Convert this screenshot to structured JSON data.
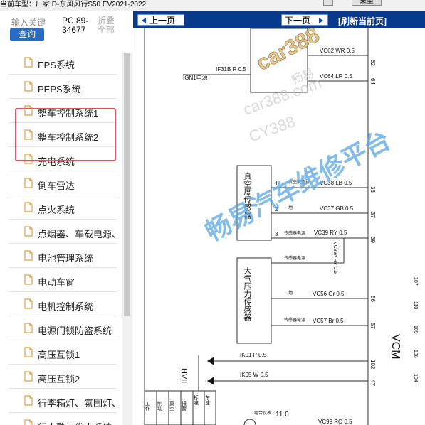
{
  "topbar": {
    "current_model": "当前车型：厂家:D-东风风行S50 EV2021-2022",
    "btn_a": "集重"
  },
  "search": {
    "placeholder_hint": "输入关键",
    "query_label": "查询",
    "code": "PC.89-34677",
    "fold_label": "折叠全部"
  },
  "sidebar": {
    "items": [
      {
        "label": "EPS系统"
      },
      {
        "label": "PEPS系统"
      },
      {
        "label": "整车控制系统1"
      },
      {
        "label": "整车控制系统2"
      },
      {
        "label": "充电系统"
      },
      {
        "label": "倒车雷达"
      },
      {
        "label": "点火系统"
      },
      {
        "label": "点烟器、车载电源、"
      },
      {
        "label": "电池管理系统"
      },
      {
        "label": "电动车窗"
      },
      {
        "label": "电机控制系统"
      },
      {
        "label": "电源门锁防盗系统"
      },
      {
        "label": "高压互锁1"
      },
      {
        "label": "高压互锁2"
      },
      {
        "label": "行李箱灯、氛围灯、"
      },
      {
        "label": "行人警示发声系统"
      }
    ]
  },
  "nav": {
    "prev_label": "上一页",
    "next_label": "下一页",
    "refresh_label": "[刷新当前页]"
  },
  "diagram": {
    "ign1": "IGN1电源",
    "f31b": "IF31B R 0.5",
    "vc62": "VC62 WR 0.5",
    "vc64": "VC64 LR 0.5",
    "pin62": "62",
    "pin64": "64",
    "vac_sensor": "真空度传感器",
    "vac_signal": "真空度信号",
    "vc38": "VC38 LB 0.5",
    "pin38": "38",
    "gnd": "地",
    "vc37": "VC37 GB 0.5",
    "pin37": "37",
    "sensor_pwr": "传感器电源",
    "vc39": "VC39 RY 0.5",
    "pin39": "39",
    "vc39a": "VC39A RY 0.5",
    "atm_sensor": "大气压力传感器",
    "vc56": "VC56 Gr 0.5",
    "pin56": "56",
    "vc57": "VC57 Br 0.5",
    "pin57": "57",
    "vcm": "VCM",
    "hvil": "HVIL",
    "ik01": "IK01 P 0.5",
    "ik05": "IK05 W 0.5",
    "pin102": "102",
    "pin47": "47",
    "pin107": "107",
    "pin110": "110",
    "pin109": "109",
    "pin108": "108",
    "pin104": "104",
    "combo": "组合仪表",
    "combo_pin": "11.0",
    "vc99": "VC99 RO 0.5",
    "pin1": "1",
    "pin2": "2",
    "pin3": "3",
    "legend1": "工作",
    "legend2": "制动",
    "legend3": "真空",
    "legend4": "报警",
    "legend5": "标准",
    "legend6": "车速"
  },
  "watermarks": {
    "brand": "car388",
    "brand_cn": "畅易",
    "url": "car388.com",
    "cy": "CY388",
    "big": "畅易汽车维修平台"
  }
}
